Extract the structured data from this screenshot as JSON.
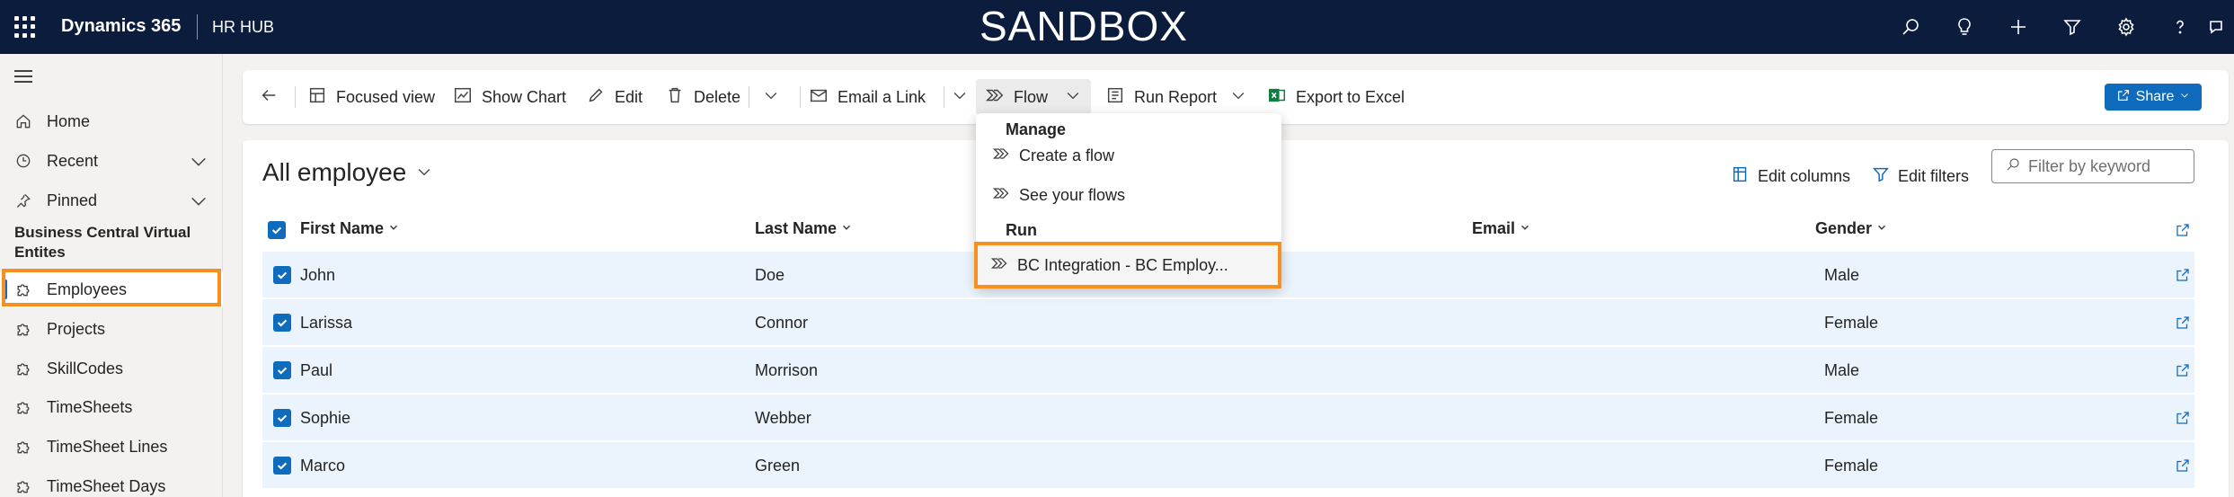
{
  "topbar": {
    "app_name": "Dynamics 365",
    "hub_name": "HR HUB",
    "environment_banner": "SANDBOX",
    "icons": [
      "search-icon",
      "lightbulb-icon",
      "plus-icon",
      "filter-icon",
      "settings-icon",
      "help-icon",
      "chat-icon"
    ]
  },
  "sidebar": {
    "items": [
      {
        "label": "Home",
        "icon": "home-icon"
      },
      {
        "label": "Recent",
        "icon": "clock-icon"
      },
      {
        "label": "Pinned",
        "icon": "pin-icon"
      }
    ],
    "section_title": "Business Central Virtual Entites",
    "entities": [
      {
        "label": "Employees",
        "icon": "puzzle-icon",
        "selected": true
      },
      {
        "label": "Projects",
        "icon": "puzzle-icon"
      },
      {
        "label": "SkillCodes",
        "icon": "puzzle-icon"
      },
      {
        "label": "TimeSheets",
        "icon": "puzzle-icon"
      },
      {
        "label": "TimeSheet Lines",
        "icon": "puzzle-icon"
      },
      {
        "label": "TimeSheet Days",
        "icon": "puzzle-icon"
      }
    ]
  },
  "commandbar": {
    "focused_view": "Focused view",
    "show_chart": "Show Chart",
    "edit": "Edit",
    "delete": "Delete",
    "email_link": "Email a Link",
    "flow": "Flow",
    "run_report": "Run Report",
    "export_excel": "Export to Excel",
    "share": "Share"
  },
  "view": {
    "title": "All employee",
    "edit_columns": "Edit columns",
    "edit_filters": "Edit filters",
    "filter_placeholder": "Filter by keyword"
  },
  "grid": {
    "columns": [
      "First Name",
      "Last Name",
      "Email",
      "Gender"
    ],
    "rows": [
      {
        "first": "John",
        "last": "Doe",
        "email": "",
        "gender": "Male"
      },
      {
        "first": "Larissa",
        "last": "Connor",
        "email": "",
        "gender": "Female"
      },
      {
        "first": "Paul",
        "last": "Morrison",
        "email": "",
        "gender": "Male"
      },
      {
        "first": "Sophie",
        "last": "Webber",
        "email": "",
        "gender": "Female"
      },
      {
        "first": "Marco",
        "last": "Green",
        "email": "",
        "gender": "Female"
      }
    ]
  },
  "flow_menu": {
    "manage_header": "Manage",
    "create_flow": "Create a flow",
    "see_flows": "See your flows",
    "run_header": "Run",
    "run_item": "BC Integration - BC Employ..."
  },
  "colors": {
    "topbar_bg": "#0b1c3c",
    "accent": "#0f6cbd",
    "highlight_box": "#f7901e",
    "selected_row_bg": "#ebf3fc"
  }
}
